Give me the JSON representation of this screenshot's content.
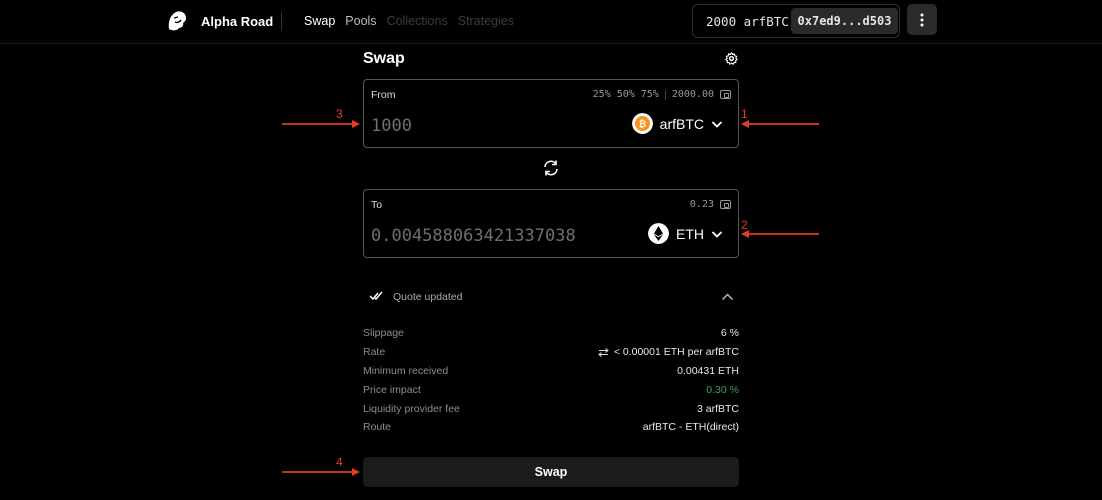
{
  "header": {
    "brand": "Alpha Road",
    "nav": [
      {
        "label": "Swap",
        "state": "active"
      },
      {
        "label": "Pools",
        "state": "enabled"
      },
      {
        "label": "Collections",
        "state": "disabled"
      },
      {
        "label": "Strategies",
        "state": "disabled"
      }
    ],
    "balance": "2000 arfBTC",
    "address": "0x7ed9...d503",
    "menu_icon": "kebab-menu-icon"
  },
  "swap": {
    "title": "Swap",
    "settings_icon": "gear-icon",
    "from": {
      "label": "From",
      "percents": [
        "25%",
        "50%",
        "75%"
      ],
      "balance": "2000.00",
      "amount_placeholder": "1000",
      "token": "arfBTC",
      "token_icon": "bitcoin-icon"
    },
    "switch_icon": "swap-direction-icon",
    "to": {
      "label": "To",
      "balance": "0.23",
      "amount_placeholder": "0.004588063421337038",
      "token": "ETH",
      "token_icon": "ethereum-icon"
    },
    "quote": {
      "status": "Quote updated"
    },
    "details": [
      {
        "key": "Slippage",
        "value": "6 %"
      },
      {
        "key": "Rate",
        "value": "< 0.00001 ETH per arfBTC"
      },
      {
        "key": "Minimum received",
        "value": "0.00431 ETH"
      },
      {
        "key": "Price impact",
        "value": "0.30 %"
      },
      {
        "key": "Liquidity provider fee",
        "value": "3 arfBTC"
      },
      {
        "key": "Route",
        "value": "arfBTC - ETH(direct)"
      }
    ],
    "submit_label": "Swap"
  },
  "annotations": [
    "1",
    "2",
    "3",
    "4"
  ],
  "colors": {
    "background": "#000000",
    "annotation": "#e53a25",
    "positive": "#3aa35a",
    "bitcoin": "#f7931a"
  }
}
